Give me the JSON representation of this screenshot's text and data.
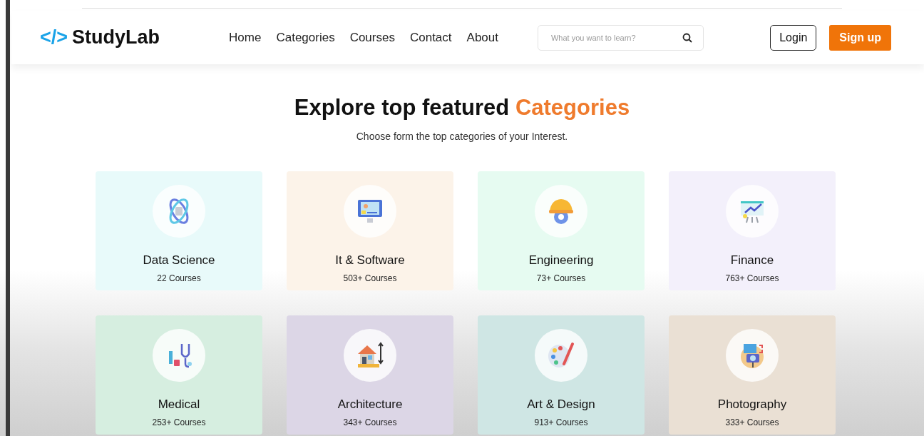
{
  "header": {
    "logo_mark": "</>",
    "logo_text": "StudyLab",
    "nav": [
      "Home",
      "Categories",
      "Courses",
      "Contact",
      "About"
    ],
    "search": {
      "placeholder": "What you want to learn?"
    },
    "login": "Login",
    "signup": "Sign up"
  },
  "hero": {
    "title": "Explore top featured **Categories**",
    "subtitle": "Choose form the top categories of your Interest."
  },
  "categories": [
    {
      "kind": "data-science",
      "name": "Data Science",
      "count": "22 Courses",
      "color": "#e8fafa"
    },
    {
      "kind": "software",
      "name": "It & Software",
      "count": "503+ Courses",
      "color": "#fcf3e9"
    },
    {
      "kind": "engineering",
      "name": "Engineering",
      "count": "73+ Courses",
      "color": "#e6fbf1"
    },
    {
      "kind": "finance",
      "name": "Finance",
      "count": "763+ Courses",
      "color": "#f3f0fb"
    },
    {
      "kind": "medical",
      "name": "Medical",
      "count": "253+ Courses",
      "color": "#d6eee0"
    },
    {
      "kind": "architecture",
      "name": "Architecture",
      "count": "343+ Courses",
      "color": "#dcd6e6"
    },
    {
      "kind": "art",
      "name": "Art & Design",
      "count": "913+ Courses",
      "color": "#cfe6e4"
    },
    {
      "kind": "photography",
      "name": "Photography",
      "count": "333+ Courses",
      "color": "#eae0d4"
    }
  ]
}
